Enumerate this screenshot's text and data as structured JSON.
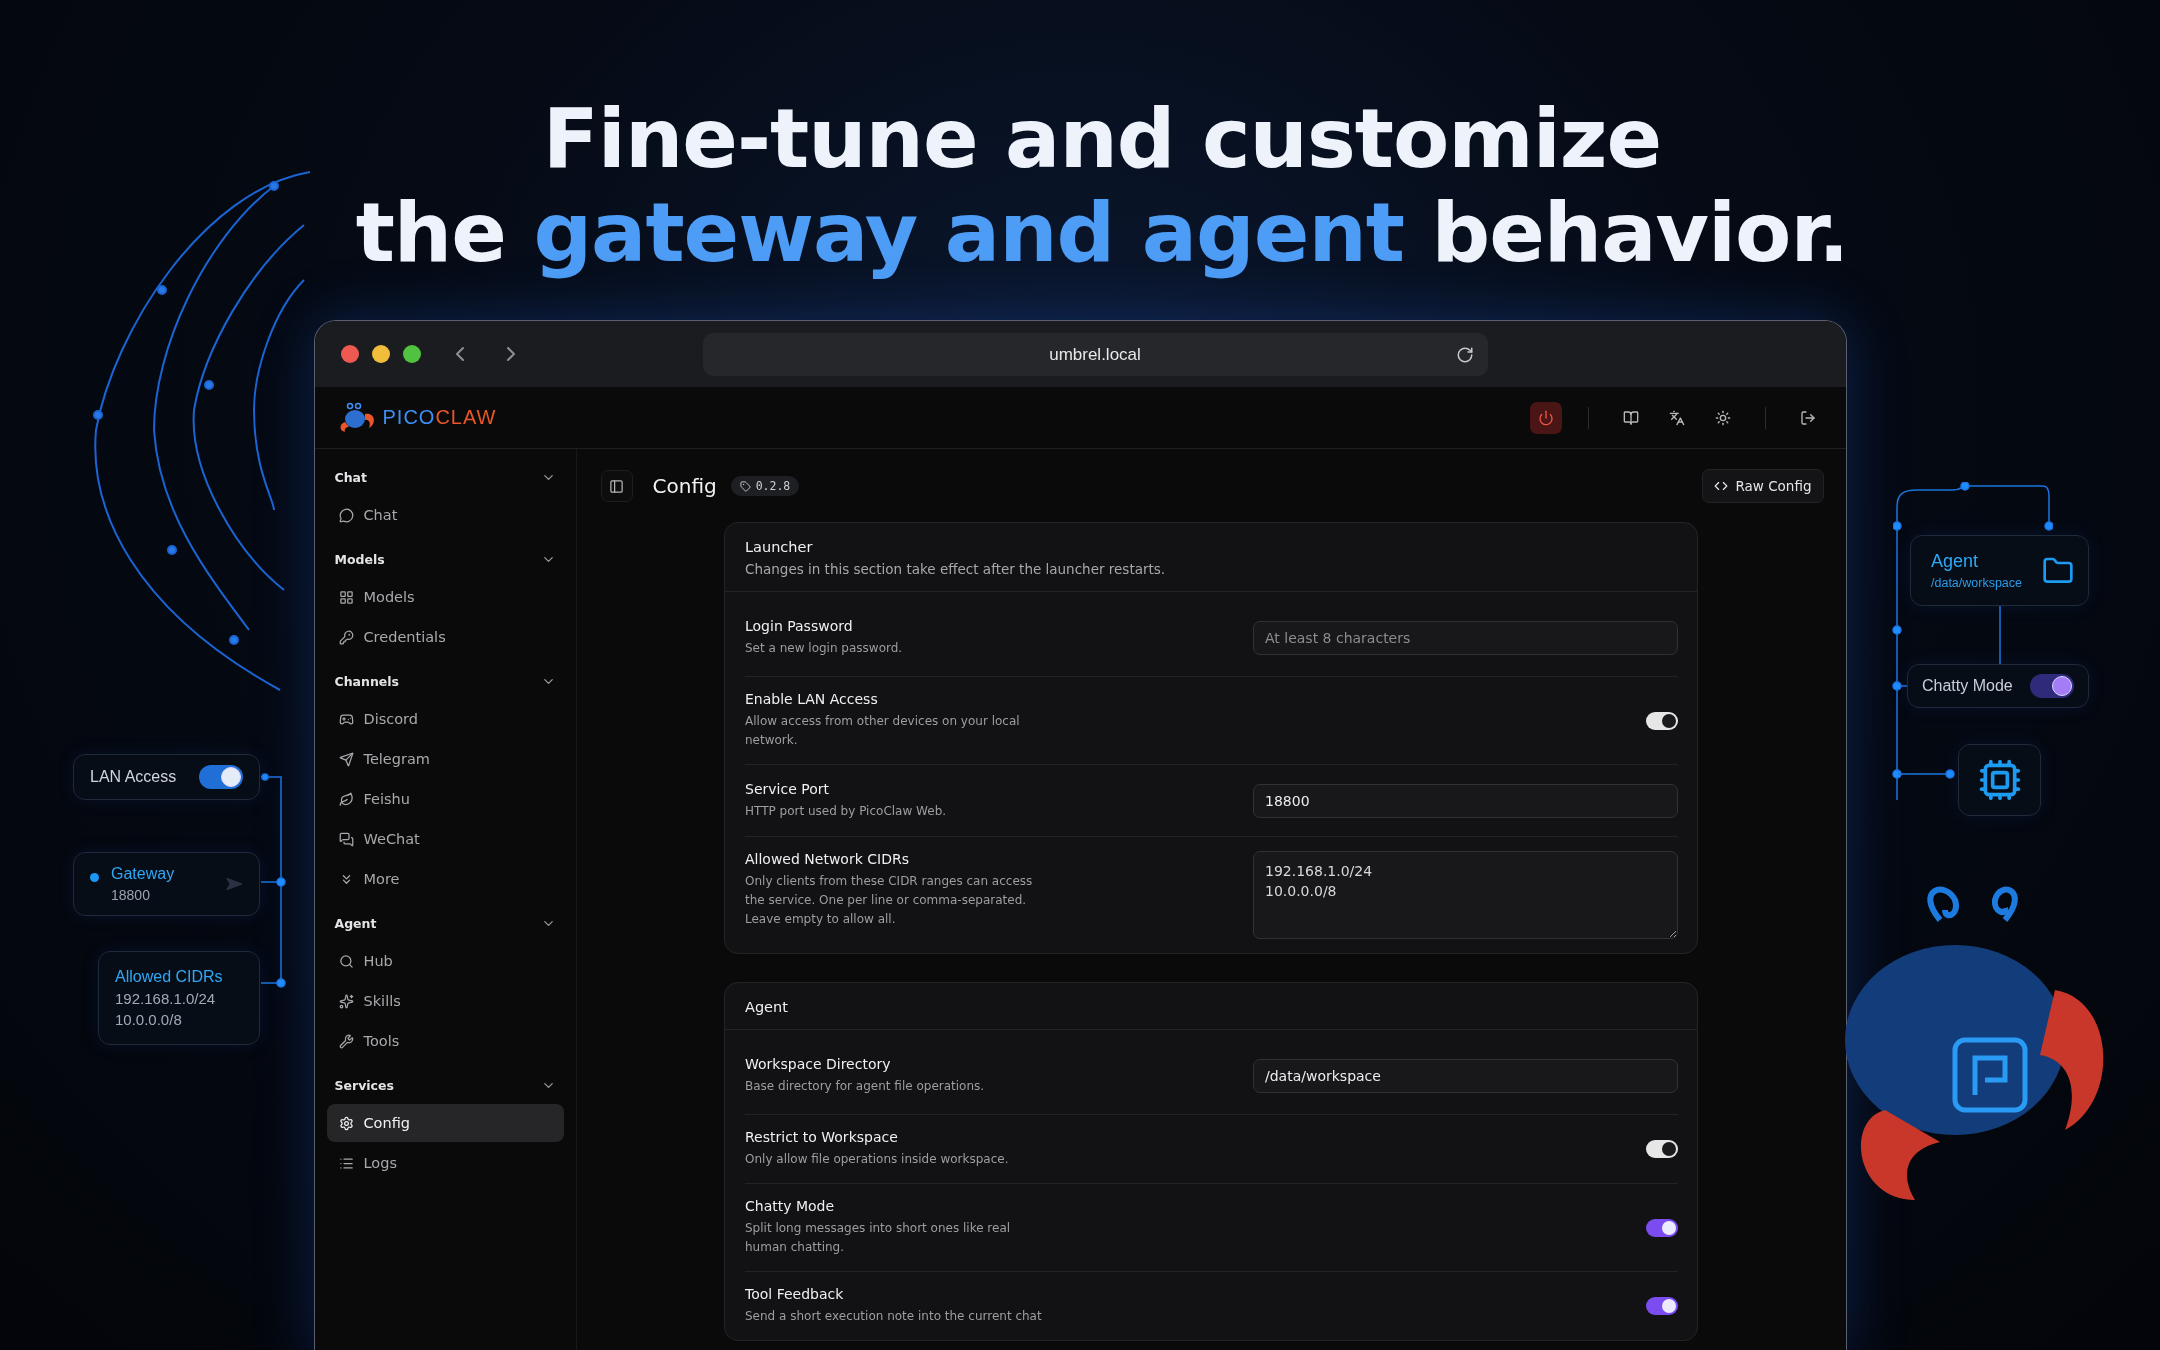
{
  "headline": {
    "line_1": "Fine-tune and customize",
    "line_2": [
      {
        "text": "the ",
        "accent": false
      },
      {
        "text": "gateway and agent",
        "accent": true
      },
      {
        "text": " behavior.",
        "accent": false
      }
    ]
  },
  "browser": {
    "address": "umbrel.local"
  },
  "app": {
    "brand": [
      {
        "text": "PICO",
        "color": "#3d8ff5"
      },
      {
        "text": "CLAW",
        "color": "#e8562a"
      }
    ],
    "sidebar": [
      {
        "title": "Chat",
        "expanded": true,
        "items": [
          {
            "label": "Chat",
            "selected": false
          }
        ]
      },
      {
        "title": "Models",
        "expanded": true,
        "items": [
          {
            "label": "Models",
            "selected": false
          },
          {
            "label": "Credentials",
            "selected": false
          }
        ]
      },
      {
        "title": "Channels",
        "expanded": true,
        "items": [
          {
            "label": "Discord",
            "selected": false
          },
          {
            "label": "Telegram",
            "selected": false
          },
          {
            "label": "Feishu",
            "selected": false
          },
          {
            "label": "WeChat",
            "selected": false
          },
          {
            "label": "More",
            "selected": false
          }
        ]
      },
      {
        "title": "Agent",
        "expanded": true,
        "items": [
          {
            "label": "Hub",
            "selected": false
          },
          {
            "label": "Skills",
            "selected": false
          },
          {
            "label": "Tools",
            "selected": false
          }
        ]
      },
      {
        "title": "Services",
        "expanded": true,
        "items": [
          {
            "label": "Config",
            "selected": true
          },
          {
            "label": "Logs",
            "selected": false
          }
        ]
      }
    ],
    "page": {
      "title": "Config",
      "version": "0.2.8",
      "raw_button": "Raw Config"
    },
    "sections": [
      {
        "title": "Launcher",
        "description": "Changes in this section take effect after the launcher restarts.",
        "fields": [
          {
            "kind": "input",
            "label": "Login Password",
            "help": "Set a new login password.",
            "placeholder": "At least 8 characters"
          },
          {
            "kind": "toggle",
            "label": "Enable LAN Access",
            "help": "Allow access from other devices on your local network.",
            "on": true,
            "color": "#e6e6e6"
          },
          {
            "kind": "input",
            "label": "Service Port",
            "help": "HTTP port used by PicoClaw Web.",
            "value": "18800"
          },
          {
            "kind": "textarea",
            "label": "Allowed Network CIDRs",
            "help": "Only clients from these CIDR ranges can access the service. One per line or comma-separated. Leave empty to allow all.",
            "value": "192.168.1.0/24\n10.0.0.0/8"
          }
        ]
      },
      {
        "title": "Agent",
        "fields": [
          {
            "kind": "input",
            "label": "Workspace Directory",
            "help": "Base directory for agent file operations.",
            "value": "/data/workspace"
          },
          {
            "kind": "toggle",
            "label": "Restrict to Workspace",
            "help": "Only allow file operations inside workspace.",
            "on": true,
            "color": "#e6e6e6"
          },
          {
            "kind": "toggle",
            "label": "Chatty Mode",
            "help": "Split long messages into short ones like real human chatting.",
            "on": true,
            "color": "#7b4cf0"
          },
          {
            "kind": "toggle",
            "label": "Tool Feedback",
            "help": "Send a short execution note into the current chat",
            "on": true,
            "color": "#7b4cf0"
          }
        ]
      }
    ]
  },
  "overlay": {
    "lan": {
      "label": "LAN Access",
      "on": true
    },
    "gateway": {
      "title": "Gateway",
      "port": "18800"
    },
    "cidrs": {
      "title": "Allowed CIDRs",
      "lines": [
        "192.168.1.0/24",
        "10.0.0.0/8"
      ]
    },
    "agent": {
      "title": "Agent",
      "path": "/data/workspace"
    },
    "chatty": {
      "label": "Chatty Mode",
      "on": true
    }
  }
}
